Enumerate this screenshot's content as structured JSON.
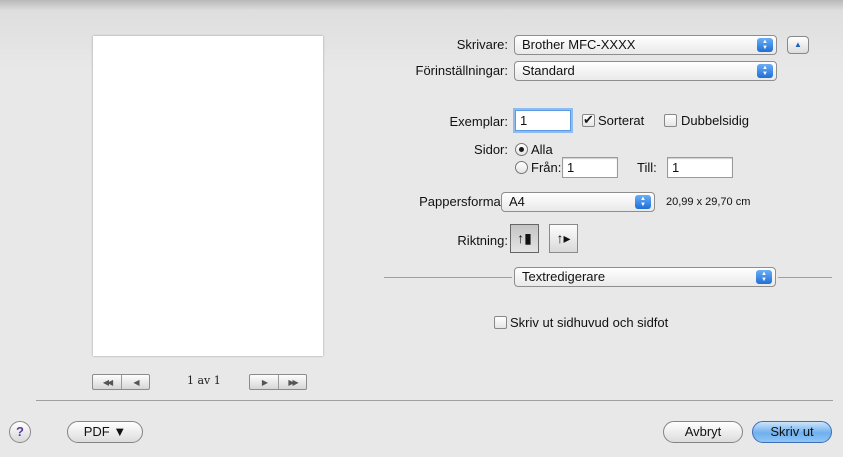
{
  "preview": {
    "page_indicator": "1 av 1",
    "nav_first": "◀◀",
    "nav_prev": "◀",
    "nav_next": "▶",
    "nav_last": "▶▶"
  },
  "printer": {
    "label": "Skrivare:",
    "value": "Brother MFC-XXXX"
  },
  "presets": {
    "label": "Förinställningar:",
    "value": "Standard"
  },
  "copies": {
    "label": "Exemplar:",
    "value": "1",
    "collated_label": "Sorterat",
    "collated_checked": true,
    "duplex_label": "Dubbelsidig",
    "duplex_checked": false
  },
  "pages": {
    "label": "Sidor:",
    "all_label": "Alla",
    "from_label": "Från:",
    "from_value": "1",
    "to_label": "Till:",
    "to_value": "1",
    "selected": "all"
  },
  "paper_size": {
    "label": "Pappersformat:",
    "value": "A4",
    "dimensions": "20,99 x 29,70 cm"
  },
  "orientation": {
    "label": "Riktning:",
    "selected": "portrait"
  },
  "section_popup": {
    "value": "Textredigerare"
  },
  "header_footer": {
    "label": "Skriv ut sidhuvud och sidfot",
    "checked": false
  },
  "footer": {
    "help": "?",
    "pdf_button": "PDF ▼",
    "cancel_button": "Avbryt",
    "print_button": "Skriv ut"
  },
  "colors": {
    "accent": "#3c7fd8",
    "default_button": "#7cb6ef",
    "background": "#e8e8e8"
  }
}
